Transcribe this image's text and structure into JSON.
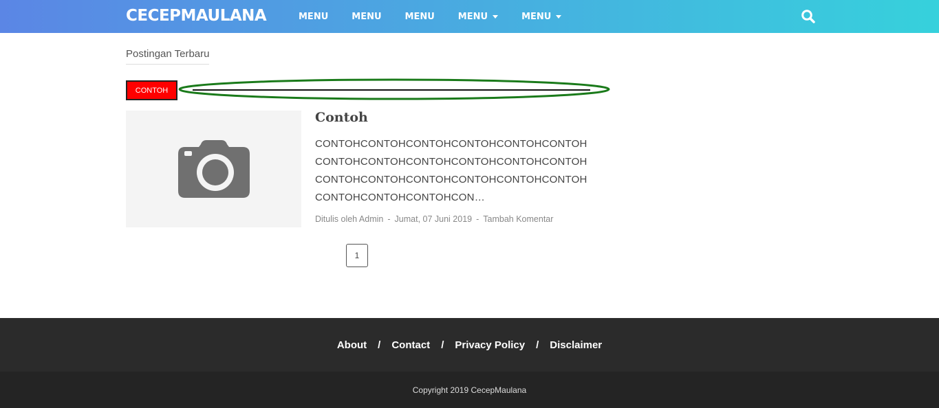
{
  "header": {
    "brand": "CECEPMAULANA",
    "menu": [
      {
        "label": "MENU",
        "has_caret": false
      },
      {
        "label": "MENU",
        "has_caret": false
      },
      {
        "label": "MENU",
        "has_caret": false
      },
      {
        "label": "MENU",
        "has_caret": true
      },
      {
        "label": "MENU",
        "has_caret": true
      }
    ],
    "search_icon": "search-icon",
    "gradient": [
      "#5b86e5",
      "#36d1dc"
    ]
  },
  "main": {
    "section_title": "Postingan Terbaru",
    "tag_label": "CONTOH",
    "tag_color": "#ff0000",
    "annotation_color": "#1a7a1a",
    "post": {
      "thumbnail_icon": "camera-icon",
      "title": "Contoh",
      "excerpt": "CONTOHCONTOHCONTOHCONTOHCONTOHCONTOHCONTOHCONTOHCONTOHCONTOHCONTOHCONTOHCONTOHCONTOHCONTOHCONTOHCONTOHCONTOHCONTOHCONTOHCONTOHCON…",
      "author": "Ditulis oleh Admin",
      "sep1": "-",
      "date": "Jumat, 07 Juni 2019",
      "sep2": "-",
      "comments": "Tambah Komentar"
    },
    "pagination": {
      "current": "1"
    }
  },
  "footer": {
    "links": [
      "About",
      "Contact",
      "Privacy Policy",
      "Disclaimer"
    ],
    "separator": "/",
    "copyright": "Copyright 2019 CecepMaulana"
  }
}
